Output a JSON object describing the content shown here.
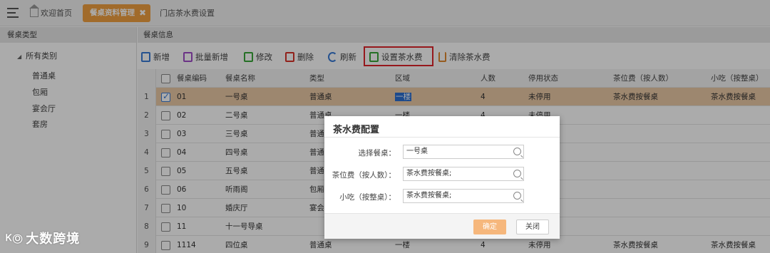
{
  "topbar": {
    "home_label": "欢迎首页",
    "active_tab_label": "餐桌资料管理",
    "active_tab_close": "✖",
    "other_tab_label": "门店茶水费设置"
  },
  "sidebar": {
    "header": "餐桌类型",
    "root_label": "所有类别",
    "items": [
      "普通桌",
      "包厢",
      "宴会厅",
      "套房"
    ]
  },
  "panel": {
    "header": "餐桌信息"
  },
  "toolbar": {
    "add": "新增",
    "batch_add": "批量新增",
    "edit": "修改",
    "delete": "删除",
    "refresh": "刷新",
    "set_tea_fee": "设置茶水费",
    "clear_tea_fee": "清除茶水费"
  },
  "grid": {
    "columns": [
      "餐桌编码",
      "餐桌名称",
      "类型",
      "区域",
      "人数",
      "停用状态",
      "茶位费（按人数）",
      "小吃（按整桌）"
    ],
    "rows": [
      {
        "num": "1",
        "checked": true,
        "code": "01",
        "name": "一号桌",
        "type": "普通桌",
        "area": "一楼",
        "people": "4",
        "status": "未停用",
        "tea": "茶水费按餐桌",
        "snack": "茶水费按餐桌"
      },
      {
        "num": "2",
        "checked": false,
        "code": "02",
        "name": "二号桌",
        "type": "普通桌",
        "area": "一楼",
        "people": "4",
        "status": "未停用",
        "tea": "",
        "snack": ""
      },
      {
        "num": "3",
        "checked": false,
        "code": "03",
        "name": "三号桌",
        "type": "普通",
        "area": "",
        "people": "",
        "status": "",
        "tea": "",
        "snack": ""
      },
      {
        "num": "4",
        "checked": false,
        "code": "04",
        "name": "四号桌",
        "type": "普通",
        "area": "",
        "people": "",
        "status": "",
        "tea": "",
        "snack": ""
      },
      {
        "num": "5",
        "checked": false,
        "code": "05",
        "name": "五号桌",
        "type": "普通",
        "area": "",
        "people": "",
        "status": "",
        "tea": "",
        "snack": ""
      },
      {
        "num": "6",
        "checked": false,
        "code": "06",
        "name": "听雨阁",
        "type": "包厢",
        "area": "",
        "people": "",
        "status": "",
        "tea": "",
        "snack": ""
      },
      {
        "num": "7",
        "checked": false,
        "code": "10",
        "name": "婚庆厅",
        "type": "宴会",
        "area": "",
        "people": "",
        "status": "",
        "tea": "",
        "snack": ""
      },
      {
        "num": "8",
        "checked": false,
        "code": "11",
        "name": "十一号导桌",
        "type": "",
        "area": "",
        "people": "",
        "status": "",
        "tea": "",
        "snack": ""
      },
      {
        "num": "9",
        "checked": false,
        "code": "1114",
        "name": "四位桌",
        "type": "普通桌",
        "area": "一楼",
        "people": "4",
        "status": "未停用",
        "tea": "茶水费按餐桌",
        "snack": "茶水费按餐桌"
      }
    ]
  },
  "dialog": {
    "title": "茶水费配置",
    "fields": [
      {
        "label": "选择餐桌：",
        "value": "一号桌"
      },
      {
        "label": "茶位费（按人数）：",
        "value": "茶水费按餐桌;"
      },
      {
        "label": "小吃（按整桌）：",
        "value": "茶水费按餐桌;"
      }
    ],
    "ok_label": "确定",
    "close_label": "关闭"
  },
  "watermark": "大数跨境",
  "colors": {
    "accent_orange": "#f0a040",
    "selected_row": "#ebc9a6",
    "highlight_red": "#e0252b",
    "ok_button": "#f6b77c"
  }
}
